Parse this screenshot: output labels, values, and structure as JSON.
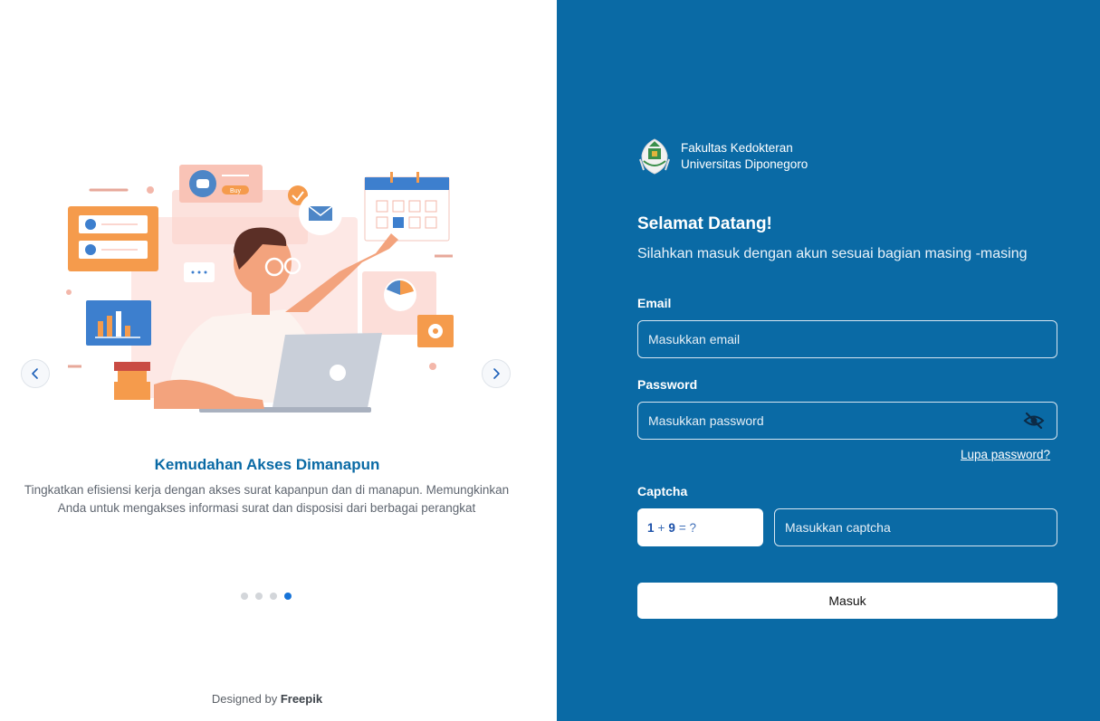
{
  "carousel": {
    "slide_title": "Kemudahan Akses Dimanapun",
    "slide_description": "Tingkatkan efisiensi kerja dengan akses surat kapanpun dan di manapun. Memungkinkan Anda untuk mengakses informasi surat dan disposisi dari berbagai perangkat",
    "illustration_buy_label": "Buy",
    "total_slides": 4,
    "active_slide": 4,
    "prev_icon": "chevron-left-icon",
    "next_icon": "chevron-right-icon"
  },
  "credit": {
    "prefix": "Designed by",
    "brand": "Freepik"
  },
  "institution": {
    "line1": "Fakultas Kedokteran",
    "line2": "Universitas Diponegoro",
    "logo_icon": "university-crest-icon"
  },
  "login": {
    "welcome": "Selamat Datang!",
    "subtitle": "Silahkan masuk dengan akun sesuai bagian masing -masing",
    "email_label": "Email",
    "email_placeholder": "Masukkan email",
    "email_value": "",
    "password_label": "Password",
    "password_placeholder": "Masukkan password",
    "password_value": "",
    "password_toggle_icon": "eye-off-icon",
    "forgot_password": "Lupa password?",
    "captcha_label": "Captcha",
    "captcha_a": "1",
    "captcha_op": "+",
    "captcha_b": "9",
    "captcha_suffix": "= ?",
    "captcha_placeholder": "Masukkan captcha",
    "submit_label": "Masuk"
  },
  "colors": {
    "panel_bg": "#0a6aa5",
    "title_blue": "#0a6aa5",
    "active_dot": "#1673d8",
    "illustration_orange": "#f59b4c",
    "illustration_pink": "#fbd6cf"
  }
}
